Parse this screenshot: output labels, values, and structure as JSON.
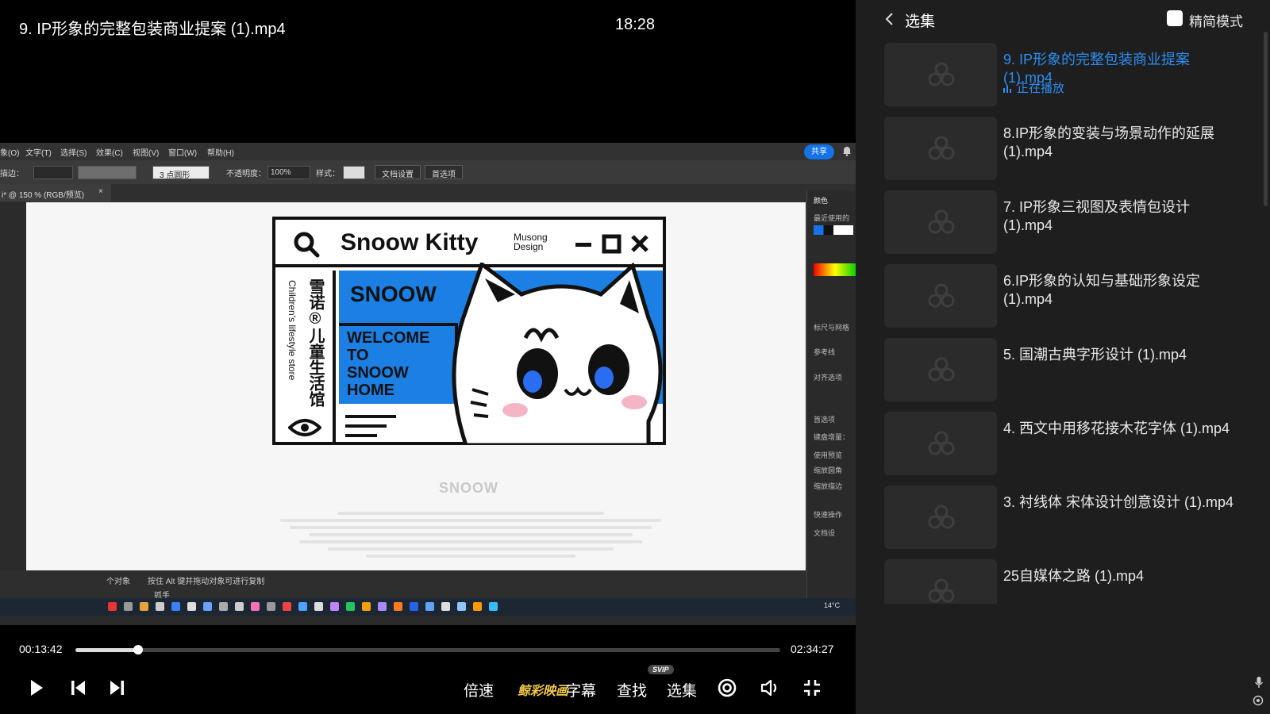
{
  "player": {
    "title": "9. IP形象的完整包装商业提案 (1).mp4",
    "clock": "18:28",
    "current_time": "00:13:42",
    "total_time": "02:34:27",
    "progress_fraction": 0.0887
  },
  "video_content": {
    "menu": [
      "象(O)",
      "文字(T)",
      "选择(S)",
      "效果(C)",
      "视图(V)",
      "窗口(W)",
      "帮助(H)"
    ],
    "share": "共享",
    "control": {
      "stroke_label": "描边：",
      "brush": "3 点圆形",
      "opacity_label": "不透明度：",
      "opacity_value": "100%",
      "style_label": "样式：",
      "doc_setup": "文档设置",
      "prefs": "首选项"
    },
    "tab": "i* @ 150 % (RGB/预览)",
    "status": "个对象",
    "status_hint": "按住 Alt 键并拖动对象可进行复制",
    "status_tool": "抓手",
    "panel": [
      "颜色",
      "最近使用的",
      "标尺与网格",
      "参考线",
      "对齐选项",
      "首选项",
      "键盘增量：",
      "使用预览",
      "缩放圆角",
      "缩放描边",
      "快速操作",
      "文档设"
    ],
    "weather": "14°C",
    "artwork": {
      "brand": "Snoow Kitty",
      "sub1": "Musong",
      "sub2": "Design",
      "snoow": "SNOOW",
      "welcome": [
        "WELCOME",
        "TO",
        "SNOOW",
        "HOME"
      ],
      "vertical_cn": "雪诺®儿童生活馆",
      "vertical_en": "Children's lifestyle store",
      "footer_brand": "SNOOW"
    }
  },
  "controls": {
    "speed": "倍速",
    "brand": "鲸彩映画",
    "subtitle": "字幕",
    "find": "查找",
    "svip": "SVIP",
    "episodes": "选集"
  },
  "playlist": {
    "title": "选集",
    "simple_mode": "精简模式",
    "now_playing": "正在播放",
    "items": [
      {
        "title": "9. IP形象的完整包装商业提案 (1).mp4",
        "active": true
      },
      {
        "title": "8.IP形象的变装与场景动作的延展 (1).mp4",
        "active": false
      },
      {
        "title": "7. IP形象三视图及表情包设计 (1).mp4",
        "active": false
      },
      {
        "title": "6.IP形象的认知与基础形象设定 (1).mp4",
        "active": false
      },
      {
        "title": "5. 国潮古典字形设计 (1).mp4",
        "active": false
      },
      {
        "title": "4. 西文中用移花接木花字体 (1).mp4",
        "active": false
      },
      {
        "title": "3. 衬线体 宋体设计创意设计 (1).mp4",
        "active": false
      },
      {
        "title": "25自媒体之路 (1).mp4",
        "active": false
      }
    ]
  },
  "colors": {
    "accent": "#2d8cf0",
    "panel_bg": "#1e1e1e",
    "artwork_blue": "#1b7fe3",
    "brand_gold": "#f2c94c"
  }
}
